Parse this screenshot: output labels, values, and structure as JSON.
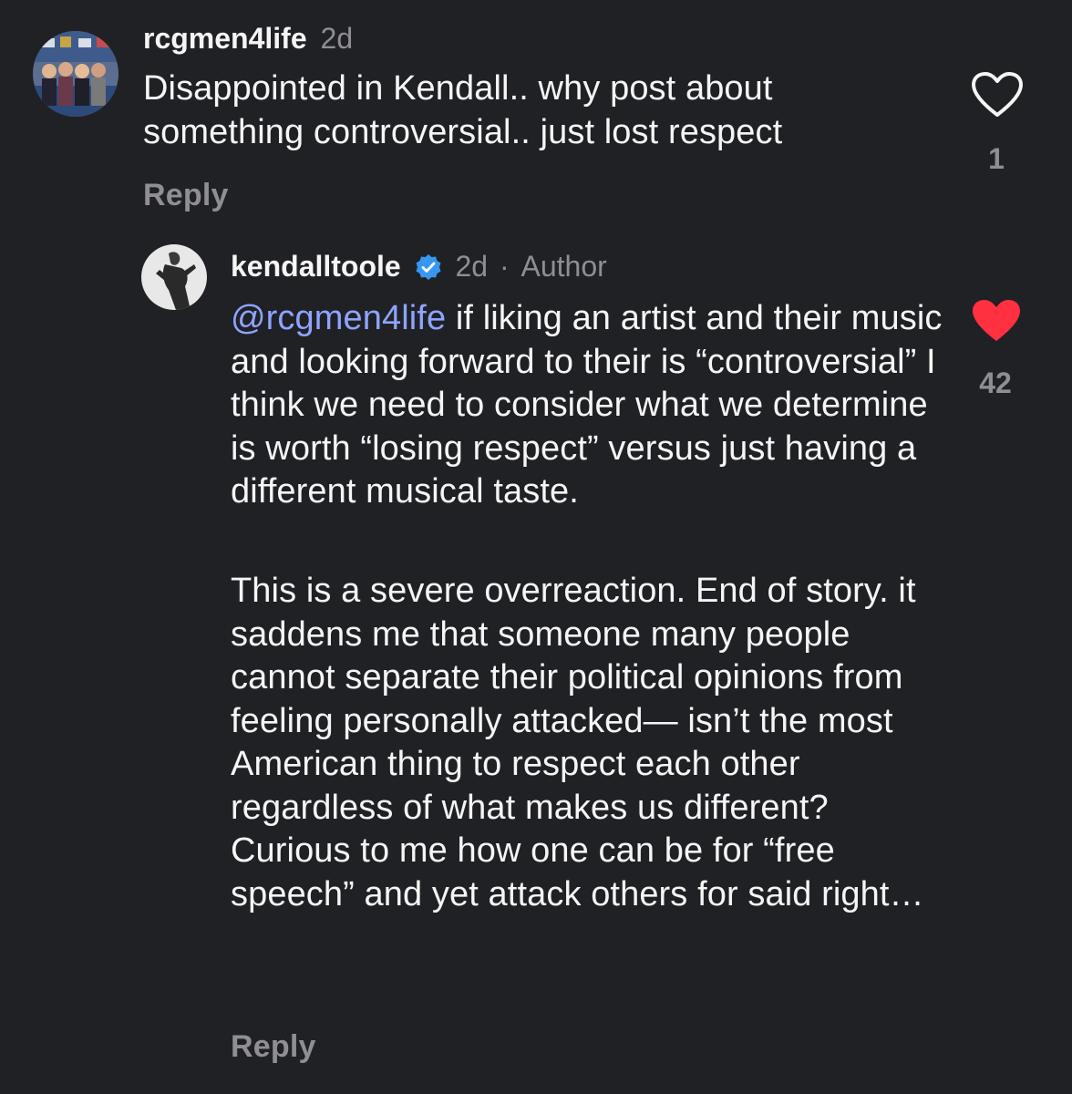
{
  "comments": [
    {
      "username": "rcgmen4life",
      "time": "2d",
      "text": "Disappointed in Kendall.. why post about something controversial.. just lost respect",
      "reply_label": "Reply",
      "likes": "1",
      "liked": false
    },
    {
      "username": "kendalltoole",
      "verified": true,
      "time": "2d",
      "author_sep": "·",
      "author_label": "Author",
      "mention": "@rcgmen4life",
      "text_p1": " if liking an artist and their music and looking forward to their is “controversial” I think we need to consider what we determine is worth “losing respect” versus just having a different musical taste.",
      "text_p2": "This is a severe overreaction. End of story. it saddens me that someone many people cannot separate their political opinions from feeling personally attacked— isn’t the most American thing to respect each other regardless of what makes us different? Curious to me how one can be for “free speech” and yet attack others for said right…",
      "reply_label": "Reply",
      "likes": "42",
      "liked": true
    }
  ],
  "colors": {
    "background": "#202125",
    "text": "#f5f5f5",
    "muted": "#8e8e93",
    "mention": "#8ea4ff",
    "like_active": "#ff3040",
    "verified": "#3897f0"
  },
  "icons": [
    "heart-outline-icon",
    "heart-filled-icon",
    "verified-badge-icon"
  ]
}
